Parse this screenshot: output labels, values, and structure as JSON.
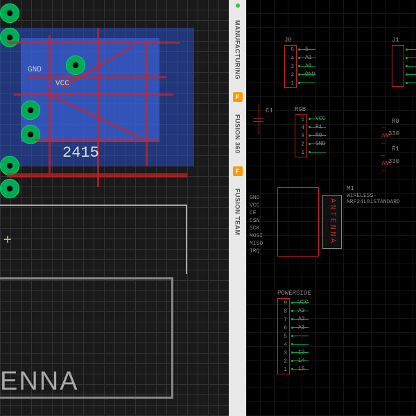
{
  "sidebar": {
    "tabs": [
      {
        "label": "MANUFACTURING"
      },
      {
        "label": "FUSION 360"
      },
      {
        "label": "FUSION TEAM"
      }
    ]
  },
  "pcb": {
    "antenna_label": "ENNA",
    "silk1": "GND",
    "silk2": "VCC",
    "silk3": "2415"
  },
  "schematic": {
    "j0": {
      "ref": "J0",
      "pins": [
        {
          "n": "5",
          "name": "5"
        },
        {
          "n": "4",
          "name": "A1"
        },
        {
          "n": "3",
          "name": "A0"
        },
        {
          "n": "2",
          "name": "GND"
        },
        {
          "n": "1",
          "name": ""
        }
      ]
    },
    "j1": {
      "ref": "J1"
    },
    "rgb": {
      "ref": "RGB",
      "pins": [
        {
          "n": "5",
          "name": "VCC"
        },
        {
          "n": "4",
          "name": "R1"
        },
        {
          "n": "3",
          "name": "R0"
        },
        {
          "n": "2",
          "name": "GND"
        },
        {
          "n": "1",
          "name": ""
        }
      ]
    },
    "c1": {
      "ref": "C1"
    },
    "r0": {
      "ref": "R0",
      "val": "330"
    },
    "r1": {
      "ref": "R1",
      "val": "330"
    },
    "m1": {
      "ref": "M1",
      "part": "WIRELESS-NRF24L01STANDARD",
      "antenna": "ANTENNA",
      "pins": [
        "GND",
        "VCC",
        "CE",
        "CSN",
        "SCK",
        "MOSI",
        "MISO",
        "IRQ"
      ]
    },
    "powerside": {
      "ref": "POWERSIDE",
      "pins": [
        {
          "n": "9",
          "name": "VCC"
        },
        {
          "n": "8",
          "name": "A3"
        },
        {
          "n": "7",
          "name": "A2"
        },
        {
          "n": "6",
          "name": "A1"
        },
        {
          "n": "5",
          "name": ""
        },
        {
          "n": "4",
          "name": ""
        },
        {
          "n": "3",
          "name": "13"
        },
        {
          "n": "2",
          "name": "14"
        },
        {
          "n": "1",
          "name": "15"
        }
      ]
    }
  }
}
